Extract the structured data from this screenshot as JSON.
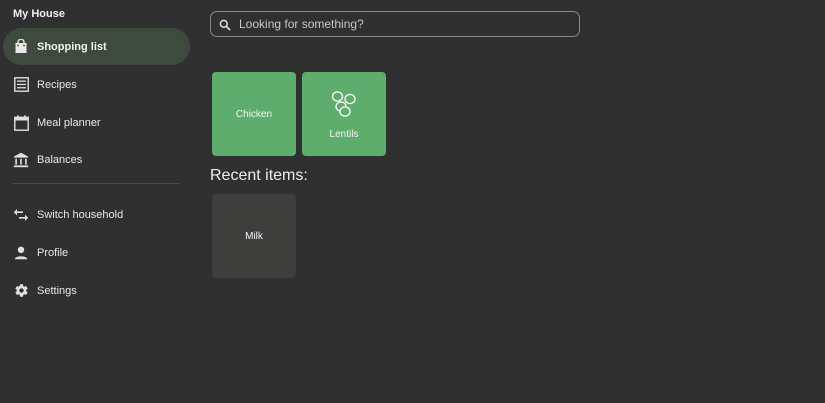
{
  "sidebar": {
    "household_name": "My House",
    "nav_items": [
      {
        "label": "Shopping list",
        "icon": "shopping-bag-icon",
        "active": true
      },
      {
        "label": "Recipes",
        "icon": "list-icon",
        "active": false
      },
      {
        "label": "Meal planner",
        "icon": "calendar-icon",
        "active": false
      },
      {
        "label": "Balances",
        "icon": "bank-icon",
        "active": false
      }
    ],
    "secondary_items": [
      {
        "label": "Switch household",
        "icon": "swap-arrows-icon"
      },
      {
        "label": "Profile",
        "icon": "person-icon"
      },
      {
        "label": "Settings",
        "icon": "gear-icon"
      }
    ]
  },
  "search": {
    "placeholder": "Looking for something?",
    "value": ""
  },
  "items": [
    {
      "label": "Chicken",
      "icon": null
    },
    {
      "label": "Lentils",
      "icon": "lentils-icon"
    }
  ],
  "recent": {
    "heading": "Recent items:",
    "items": [
      {
        "label": "Milk"
      }
    ]
  },
  "colors": {
    "background": "#303030",
    "accent_green": "#5fad6c",
    "active_nav": "#3f4a3f",
    "recent_tile": "#3e3f3c"
  }
}
